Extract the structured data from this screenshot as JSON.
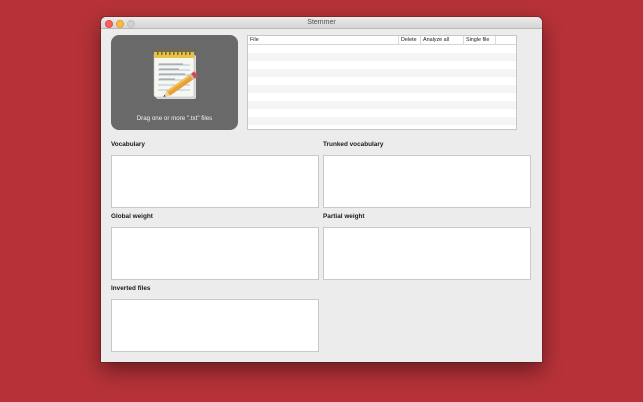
{
  "window": {
    "title": "Stemmer"
  },
  "dropzone": {
    "label": "Drag one or more \".txt\" files",
    "icon": "notepad-pencil-icon"
  },
  "file_table": {
    "columns": [
      "File",
      "Delete",
      "Analyze all",
      "Single file"
    ],
    "rows": []
  },
  "sections": {
    "vocabulary": "Vocabulary",
    "trunked_vocabulary": "Trunked vocabulary",
    "global_weight": "Global weight",
    "partial_weight": "Partial weight",
    "inverted_files": "Inverted files"
  },
  "colors": {
    "desktop": "#b63238",
    "dropzone": "#696969",
    "window": "#ececec"
  }
}
